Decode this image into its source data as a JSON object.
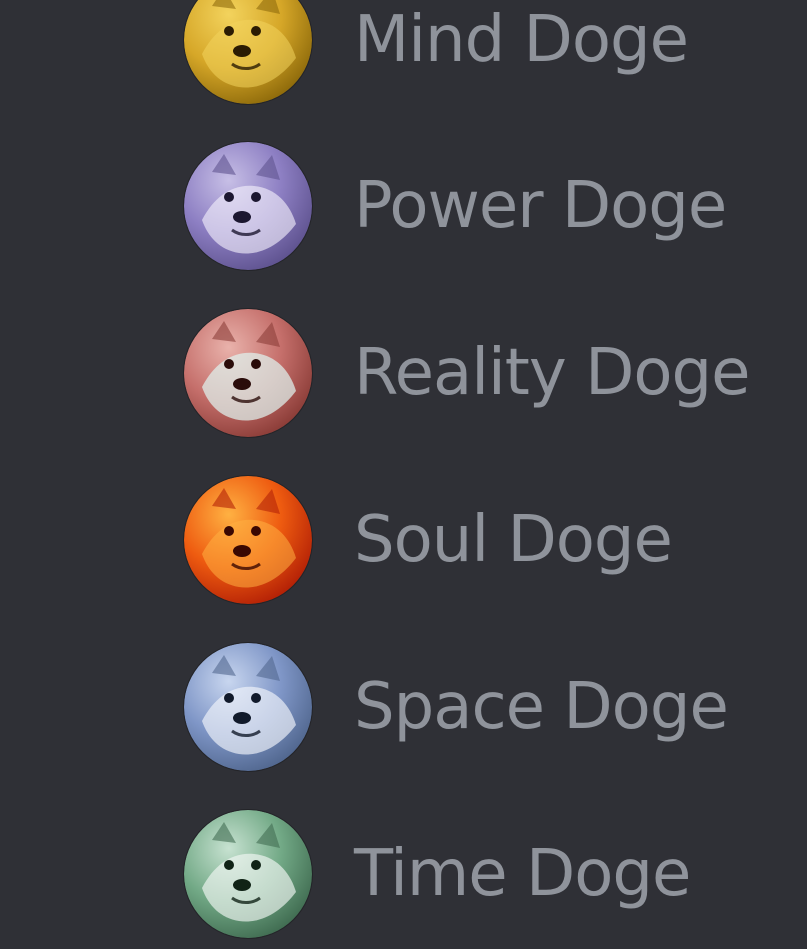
{
  "members": [
    {
      "name": "Mind Doge",
      "avatar_icon": "doge-avatar-icon",
      "color_base": "#d6a728",
      "color_light": "#f3d35d",
      "color_dark": "#8f6b0b"
    },
    {
      "name": "Power Doge",
      "avatar_icon": "doge-avatar-icon",
      "color_base": "#8d7fc3",
      "color_light": "#c7bfe6",
      "color_dark": "#5f5390"
    },
    {
      "name": "Reality Doge",
      "avatar_icon": "doge-avatar-icon",
      "color_base": "#c56f6b",
      "color_light": "#e9b2ab",
      "color_dark": "#8c3d38"
    },
    {
      "name": "Soul Doge",
      "avatar_icon": "doge-avatar-icon",
      "color_base": "#ee5b10",
      "color_light": "#ffb142",
      "color_dark": "#b42106"
    },
    {
      "name": "Space Doge",
      "avatar_icon": "doge-avatar-icon",
      "color_base": "#7f96c7",
      "color_light": "#c8d6ef",
      "color_dark": "#51678f"
    },
    {
      "name": "Time Doge",
      "avatar_icon": "doge-avatar-icon",
      "color_base": "#72a986",
      "color_light": "#c7e2d1",
      "color_dark": "#416d52"
    }
  ]
}
